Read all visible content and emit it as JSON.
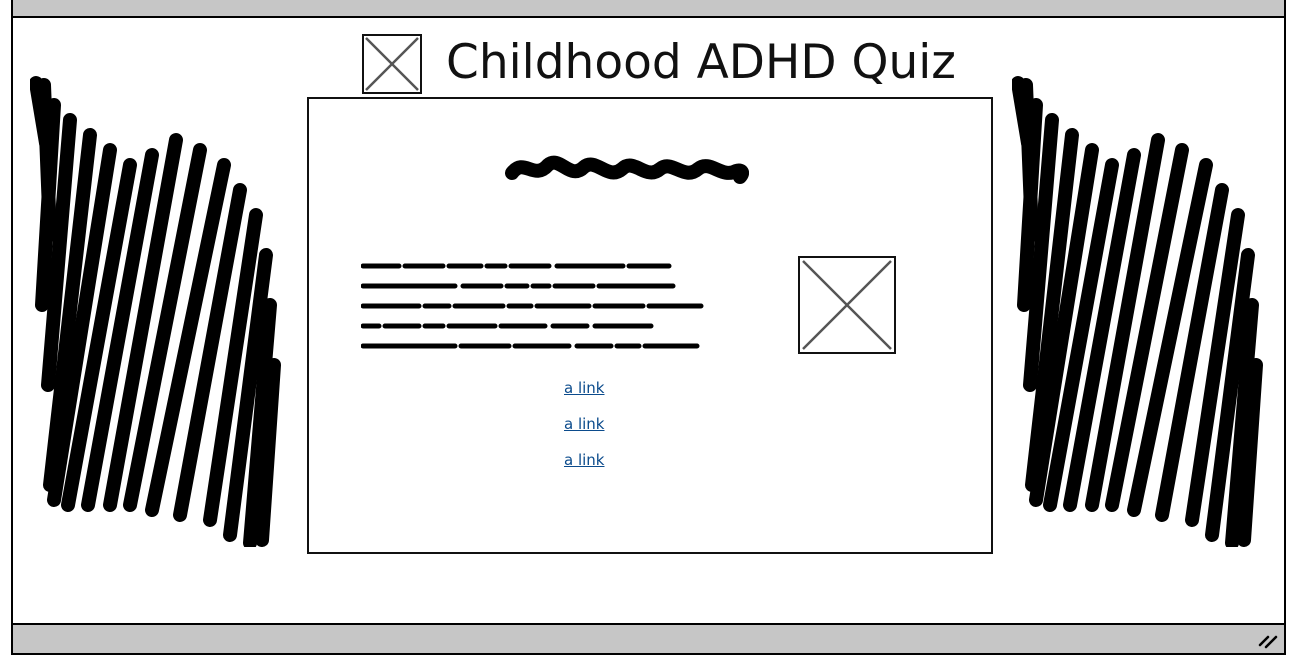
{
  "header": {
    "title": "Childhood ADHD Quiz",
    "logo_icon": "image-placeholder-icon"
  },
  "card": {
    "heading_icon": "scribbled-heading",
    "text_icon": "scribbled-paragraph",
    "image_icon": "image-placeholder-icon",
    "links": [
      {
        "label": "a link"
      },
      {
        "label": "a link"
      },
      {
        "label": "a link"
      }
    ]
  },
  "sidebars": {
    "left_icon": "scribble-block",
    "right_icon": "scribble-block"
  },
  "colors": {
    "chrome": "#c6c6c6",
    "ink": "#111111",
    "link": "#0b4b8c"
  }
}
